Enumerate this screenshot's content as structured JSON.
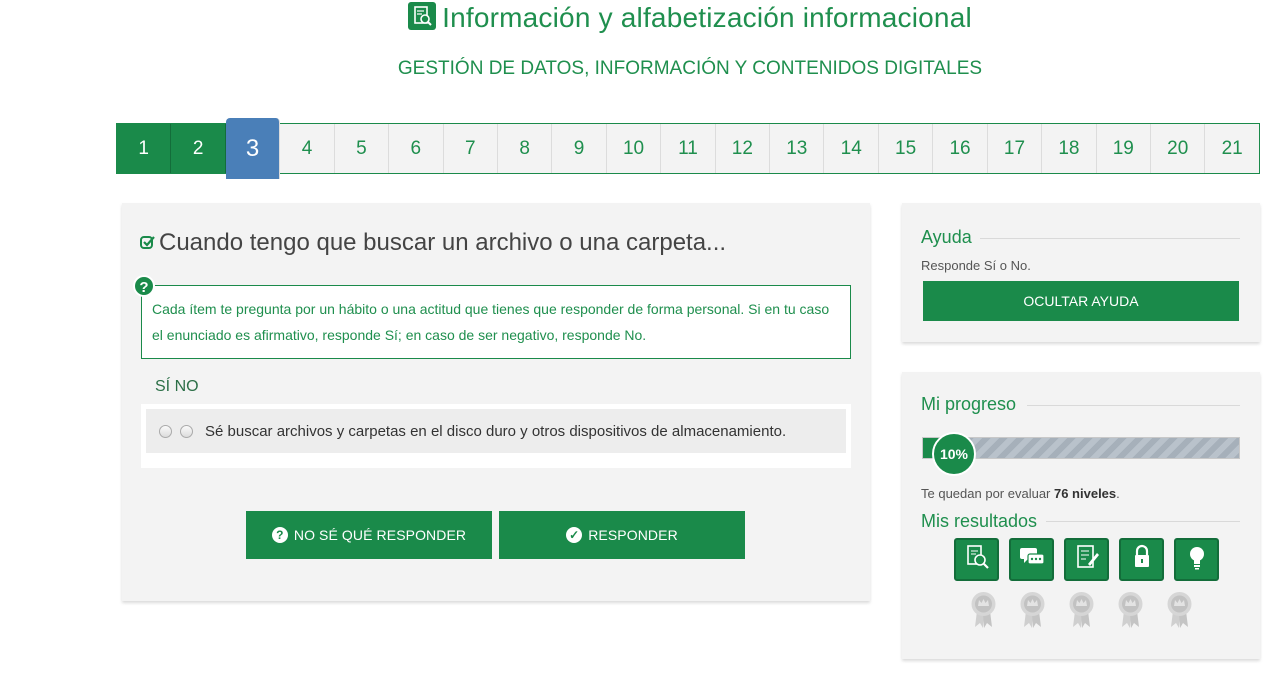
{
  "header": {
    "title": "Información y alfabetización informacional",
    "subtitle": "GESTIÓN DE DATOS, INFORMACIÓN Y CONTENIDOS DIGITALES",
    "title_icon": "document-search-icon"
  },
  "stepper": {
    "steps": [
      "1",
      "2",
      "3",
      "4",
      "5",
      "6",
      "7",
      "8",
      "9",
      "10",
      "11",
      "12",
      "13",
      "14",
      "15",
      "16",
      "17",
      "18",
      "19",
      "20",
      "21"
    ],
    "current": "3",
    "completed": [
      "1",
      "2"
    ]
  },
  "question": {
    "title": "Cuando tengo que buscar un archivo o una carpeta...",
    "hint": "Cada ítem te pregunta por un hábito o una actitud que tienes que responder de forma personal. Si en tu caso el enunciado es afirmativo, responde Sí; en caso de ser negativo, responde No.",
    "yes_no_header": "SÍ NO",
    "items": [
      {
        "text": "Sé buscar archivos y carpetas en el disco duro y otros dispositivos de almacenamiento."
      }
    ],
    "dont_know_label": "NO SÉ QUÉ RESPONDER",
    "answer_label": "RESPONDER"
  },
  "help": {
    "heading": "Ayuda",
    "text": "Responde Sí o No.",
    "hide_label": "OCULTAR AYUDA"
  },
  "progress": {
    "heading": "Mi progreso",
    "percent_label": "10%",
    "percent": 10,
    "remaining_prefix": "Te quedan por evaluar ",
    "remaining_count": "76 niveles",
    "remaining_suffix": "."
  },
  "results": {
    "heading": "Mis resultados",
    "badges": [
      "document-search-icon",
      "chat-bubbles-icon",
      "edit-document-icon",
      "lock-icon",
      "lightbulb-icon"
    ],
    "medals": [
      "medal-icon",
      "medal-icon",
      "medal-icon",
      "medal-icon",
      "medal-icon"
    ]
  },
  "colors": {
    "primary": "#1a8a4a",
    "current_step": "#4a7fb8",
    "panel": "#f3f3f3"
  }
}
